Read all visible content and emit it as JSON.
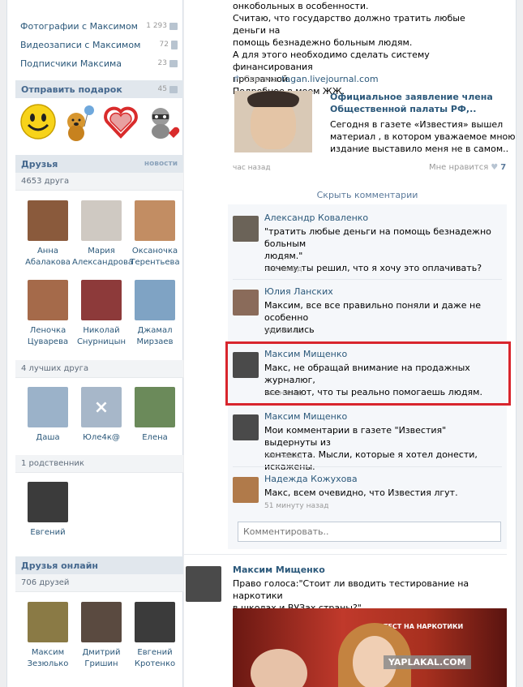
{
  "left": {
    "menu": [
      {
        "label": "Фотографии с Максимом",
        "count": "1 293",
        "icon": "camera-icon"
      },
      {
        "label": "Видеозаписи с Максимом",
        "count": "72",
        "icon": "film-icon"
      },
      {
        "label": "Подписчики Максима",
        "count": "23",
        "icon": "people-icon"
      }
    ],
    "gift": {
      "title": "Отправить подарок",
      "count": "45"
    },
    "friends": {
      "title": "Друзья",
      "news": "новости",
      "count": "4653 друга",
      "people": [
        {
          "first": "Анна",
          "last": "Абалакова",
          "color": "#8a5a3c"
        },
        {
          "first": "Мария",
          "last": "Александрова",
          "color": "#cfc9c2"
        },
        {
          "first": "Оксаночка",
          "last": "Терентьева",
          "color": "#c28d63"
        },
        {
          "first": "Леночка",
          "last": "Цуварева",
          "color": "#a56a4a"
        },
        {
          "first": "Николай",
          "last": "Снурницын",
          "color": "#8d3a3a"
        },
        {
          "first": "Джамал",
          "last": "Мирзаев",
          "color": "#7fa3c4"
        }
      ]
    },
    "best": {
      "count": "4 лучших друга",
      "people": [
        {
          "name": "Даша",
          "color": "#9bb2c9"
        },
        {
          "name": "Юле4к@",
          "color": "#a7b7c9"
        },
        {
          "name": "Елена",
          "color": "#6b8a5a"
        }
      ]
    },
    "relatives": {
      "count": "1 родственник",
      "people": [
        {
          "name": "Евгений",
          "color": "#3b3b3b"
        }
      ]
    },
    "online": {
      "title": "Друзья онлайн",
      "count": "706 друзей",
      "people": [
        {
          "first": "Максим",
          "last": "Зезюлько",
          "color": "#8a7a45"
        },
        {
          "first": "Дмитрий",
          "last": "Гришин",
          "color": "#5a4a40"
        },
        {
          "first": "Евгений",
          "last": "Кротенко",
          "color": "#3b3b3b"
        }
      ]
    }
  },
  "post": {
    "lines": [
      "онкобольных в особенности.",
      "Считаю, что государство должно тратить любые деньги на",
      "помощь безнадежно больным людям.",
      "А для этого необходимо сделать систему финансирования",
      "прозрачной.",
      "Подробнее в моем ЖЖ."
    ],
    "link_prefix": "Ссылка",
    "link_url": "tagan.livejournal.com",
    "card": {
      "title_line1": "Официальное заявление члена",
      "title_line2": "Общественной палаты РФ,..",
      "desc_line1": "Сегодня в газете «Известия» вышел",
      "desc_line2": "материал , в котором уважаемое мною",
      "desc_line3": "издание выставило меня не в самом.."
    },
    "time": "час назад",
    "like_label": "Мне нравится",
    "like_count": "7",
    "hide_comments": "Скрыть комментарии"
  },
  "comments": [
    {
      "name": "Александр Коваленко",
      "lines": [
        "\"тратить любые деньги на помощь безнадежно больным",
        "людям.\"",
        "почему ты решил, что я хочу это оплачивать?"
      ],
      "time": "час назад",
      "color": "#6b6358"
    },
    {
      "name": "Юлия Ланских",
      "lines": [
        "Максим, все все правильно поняли и даже не особенно",
        "удивились"
      ],
      "time": "час назад",
      "color": "#8a6b5a"
    },
    {
      "name": "Максим Мищенко",
      "lines": [
        "Макс, не обращай внимание на продажных журналюг,",
        "все знают, что ты реально помогаешь людям."
      ],
      "time": "час назад",
      "color": "#4a4a4a"
    },
    {
      "name": "Максим Мищенко",
      "lines": [
        "Мои комментарии в газете \"Известия\" выдернуты из",
        "контекста. Мысли, которые я хотел донести, искажены."
      ],
      "time": "час назад",
      "color": "#4a4a4a"
    },
    {
      "name": "Надежда Кожухова",
      "lines": [
        "Макс, всем очевидно, что Известия лгут."
      ],
      "time": "51 минуту назад",
      "color": "#b07a4a"
    }
  ],
  "comment_placeholder": "Комментировать..",
  "post2": {
    "author": "Максим Мищенко",
    "line1": "Право голоса:\"Стоит ли вводить тестирование на наркотики",
    "line2": "в школах и ВУЗах страны?\"",
    "video_caption": "ТЕСТ НА НАРКОТИКИ",
    "watermark": "YAPLAKAL.COM"
  }
}
